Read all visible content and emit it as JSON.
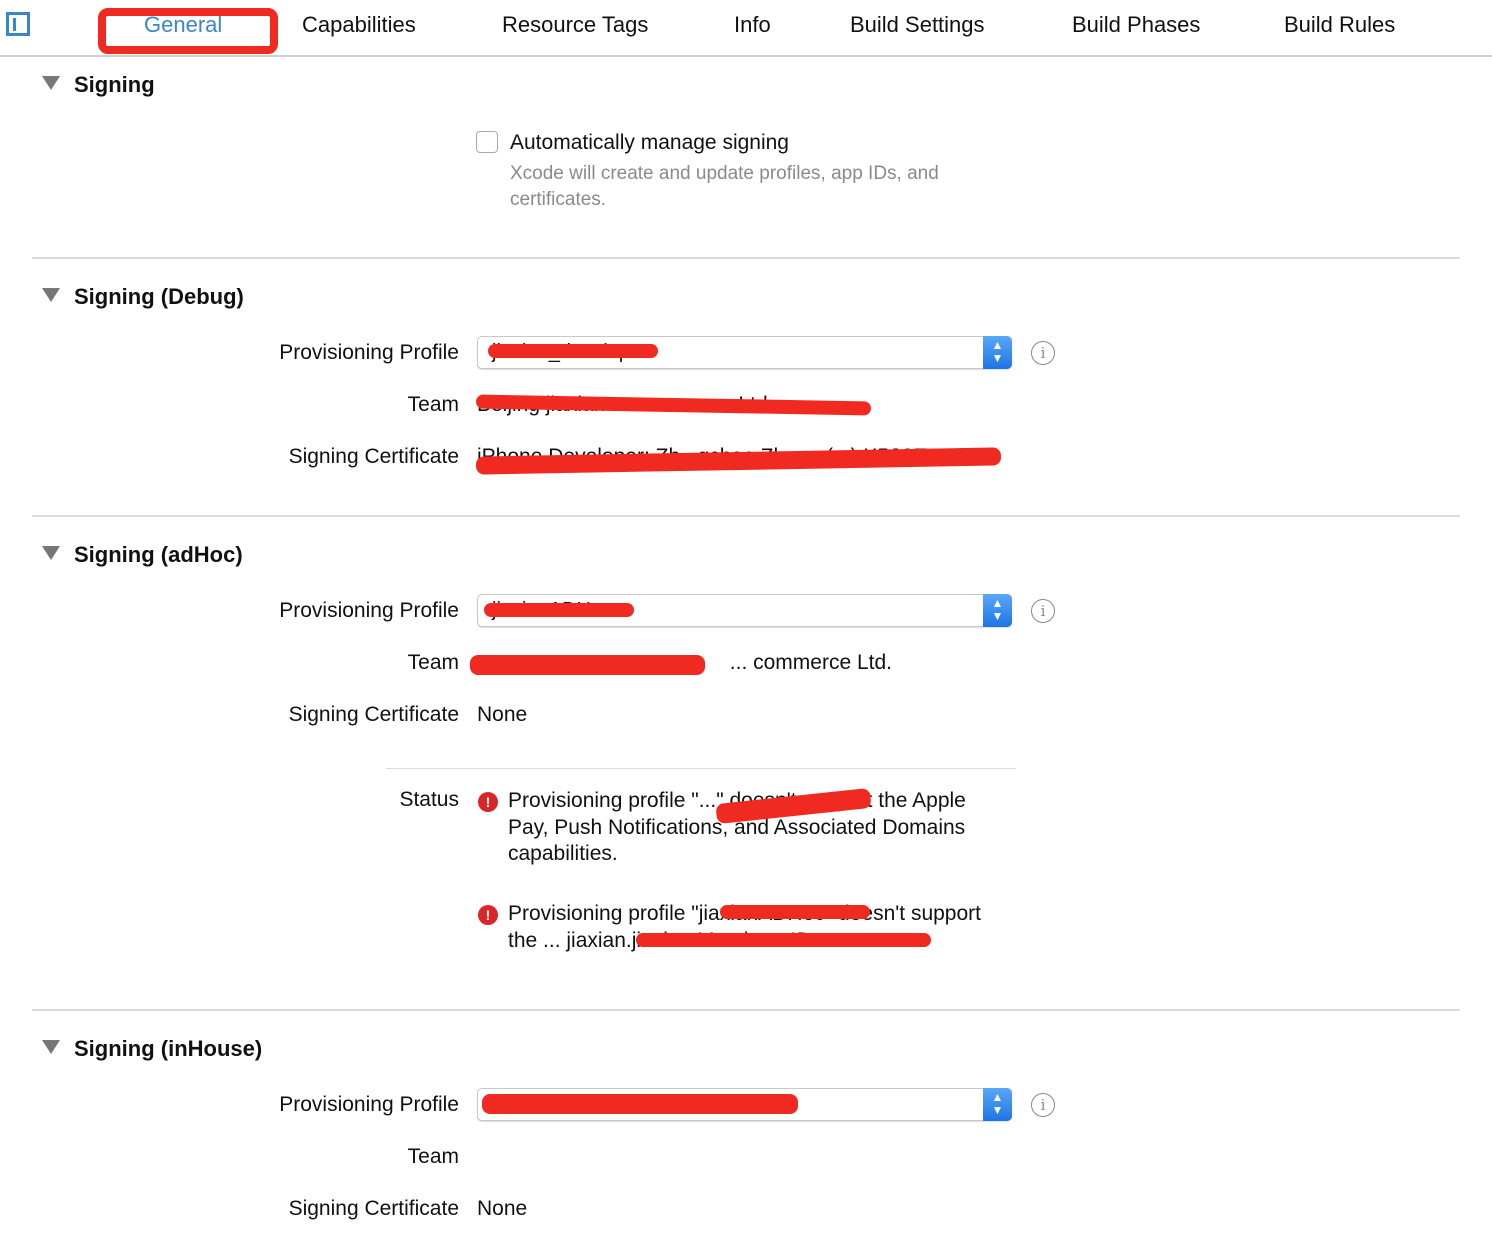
{
  "tabs": [
    "General",
    "Capabilities",
    "Resource Tags",
    "Info",
    "Build Settings",
    "Build Phases",
    "Build Rules"
  ],
  "active_tab": "General",
  "signing": {
    "title": "Signing",
    "auto_label": "Automatically manage signing",
    "auto_checked": false,
    "auto_desc": "Xcode will create and update profiles, app IDs, and certificates."
  },
  "labels": {
    "profile": "Provisioning Profile",
    "team": "Team",
    "cert": "Signing Certificate",
    "status": "Status"
  },
  "debug": {
    "title": "Signing (Debug)",
    "profile": "jiaxian_develop",
    "team": "Beijing jiaxian ... commerce Ltd.",
    "cert": "iPhone Developer: Zh...qchao Zhang (...) K5JCT..."
  },
  "adhoc": {
    "title": "Signing (adHoc)",
    "profile": "jiaxianADHoc",
    "team": "... commerce Ltd.",
    "cert": "None",
    "status": [
      "Provisioning profile \"...\" doesn't support the Apple Pay, Push Notifications, and Associated Domains capabilities.",
      "Provisioning profile \"jiaxianADHoc\" doesn't support the ... jiaxian.jiaxian Merchant ID."
    ]
  },
  "inhouse": {
    "title": "Signing (inHouse)",
    "profile": "...",
    "team": "",
    "cert": "None"
  },
  "colors": {
    "accent": "#3a86c8",
    "error": "#d8262a",
    "redaction": "#f02a20"
  }
}
